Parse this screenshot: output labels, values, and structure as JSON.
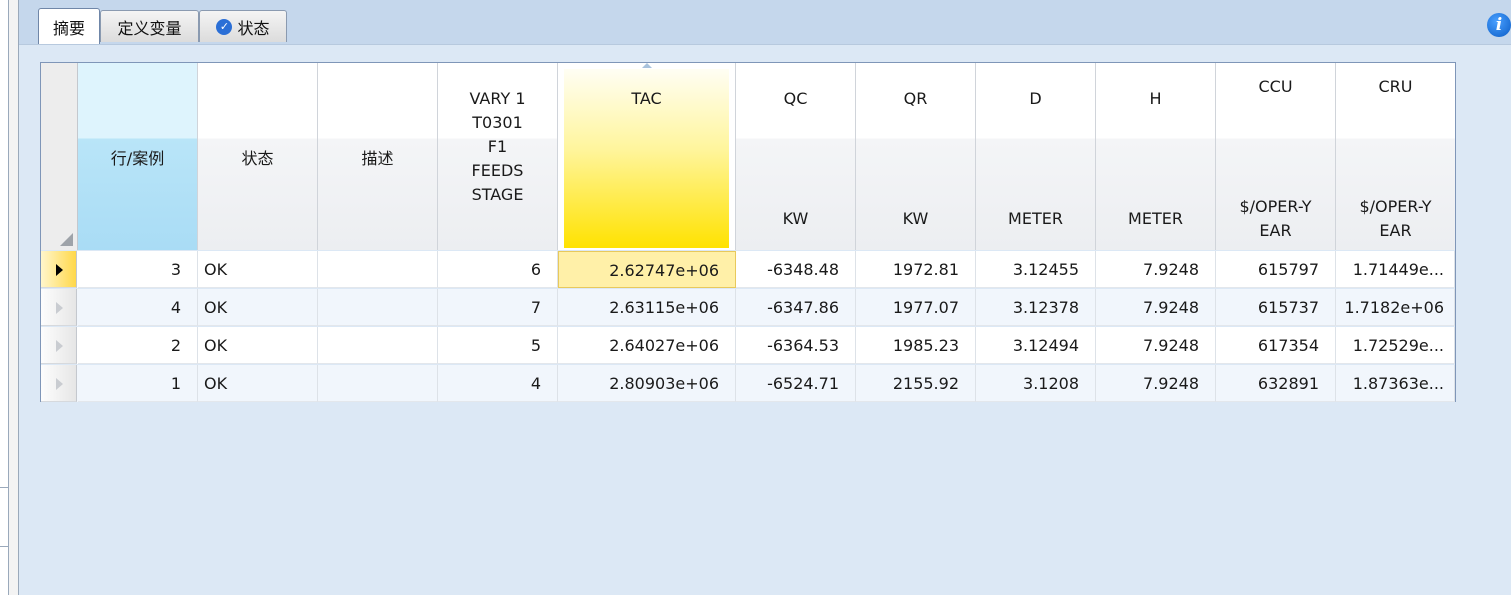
{
  "tabs": [
    {
      "label": "摘要",
      "icon": ""
    },
    {
      "label": "定义变量",
      "icon": ""
    },
    {
      "label": "状态",
      "icon": "check-circle-icon"
    }
  ],
  "info_glyph": "i",
  "grid": {
    "columns": [
      {
        "title": "行/案例",
        "unit": ""
      },
      {
        "title": "状态",
        "unit": ""
      },
      {
        "title": "描述",
        "unit": ""
      },
      {
        "title": "VARY   1\nT0301\nF1\nFEEDS\nSTAGE",
        "unit": ""
      },
      {
        "title": "TAC",
        "unit": ""
      },
      {
        "title": "QC",
        "unit": "KW"
      },
      {
        "title": "QR",
        "unit": "KW"
      },
      {
        "title": "D",
        "unit": "METER"
      },
      {
        "title": "H",
        "unit": "METER"
      },
      {
        "title": "CCU",
        "unit": "$/OPER-Y\nEAR"
      },
      {
        "title": "CRU",
        "unit": "$/OPER-Y\nEAR"
      }
    ],
    "rows": [
      {
        "case": "3",
        "status": "OK",
        "desc": "",
        "vary": "6",
        "tac": "2.62747e+06",
        "qc": "-6348.48",
        "qr": "1972.81",
        "d": "3.12455",
        "h": "7.9248",
        "ccu": "615797",
        "cru": "1.71449e..."
      },
      {
        "case": "4",
        "status": "OK",
        "desc": "",
        "vary": "7",
        "tac": "2.63115e+06",
        "qc": "-6347.86",
        "qr": "1977.07",
        "d": "3.12378",
        "h": "7.9248",
        "ccu": "615737",
        "cru": "1.7182e+06"
      },
      {
        "case": "2",
        "status": "OK",
        "desc": "",
        "vary": "5",
        "tac": "2.64027e+06",
        "qc": "-6364.53",
        "qr": "1985.23",
        "d": "3.12494",
        "h": "7.9248",
        "ccu": "617354",
        "cru": "1.72529e..."
      },
      {
        "case": "1",
        "status": "OK",
        "desc": "",
        "vary": "4",
        "tac": "2.80903e+06",
        "qc": "-6524.71",
        "qr": "2155.92",
        "d": "3.1208",
        "h": "7.9248",
        "ccu": "632891",
        "cru": "1.87363e..."
      }
    ]
  },
  "colors": {
    "tab_strip": "#c5d7ec",
    "background": "#dce8f5",
    "row_header_accent": "#b9e5f8",
    "sorted_column_accent": "#ffe200",
    "selected_cell": "#fff0a8"
  }
}
